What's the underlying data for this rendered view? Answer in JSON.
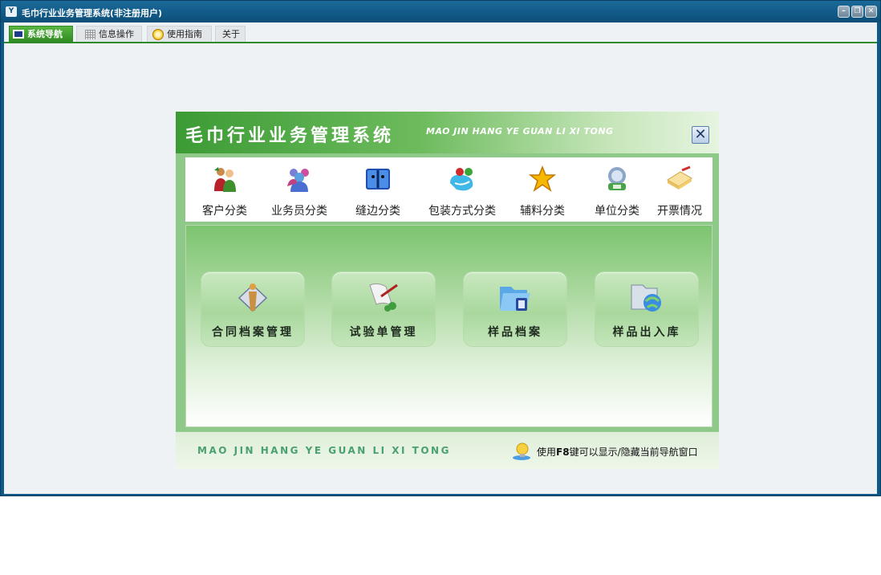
{
  "window": {
    "title": "毛巾行业业务管理系统(非注册用户)",
    "app_icon": "app-logo-icon",
    "controls": [
      "minimize-icon",
      "restore-icon",
      "close-icon"
    ]
  },
  "tabs": [
    {
      "label": "系统导航",
      "icon": "monitor-icon",
      "active": true
    },
    {
      "label": "信息操作",
      "icon": "grid-icon",
      "active": false
    },
    {
      "label": "使用指南",
      "icon": "clock-icon",
      "active": false
    },
    {
      "label": "关于",
      "icon": "",
      "active": false
    }
  ],
  "navigator": {
    "title": "毛巾行业业务管理系统",
    "subtitle": "MAO JIN HANG YE GUAN LI XI TONG",
    "close_symbol": "✕",
    "toolbar": [
      {
        "label": "客户分类",
        "icon": "customers-icon"
      },
      {
        "label": "业务员分类",
        "icon": "salesmen-icon"
      },
      {
        "label": "缝边分类",
        "icon": "sewing-edge-icon"
      },
      {
        "label": "包装方式分类",
        "icon": "packaging-icon"
      },
      {
        "label": "辅料分类",
        "icon": "star-icon"
      },
      {
        "label": "单位分类",
        "icon": "unit-icon"
      },
      {
        "label": "开票情况",
        "icon": "invoice-icon"
      }
    ],
    "main_buttons": [
      {
        "label": "合同档案管理",
        "icon": "contract-icon"
      },
      {
        "label": "试验单管理",
        "icon": "test-sheet-icon"
      },
      {
        "label": "样品档案",
        "icon": "sample-folder-icon"
      },
      {
        "label": "样品出入库",
        "icon": "sample-inout-icon"
      }
    ],
    "footer": {
      "text": "MAO JIN HANG YE GUAN LI XI TONG",
      "hint_prefix": "使用",
      "hint_key": "F8",
      "hint_suffix": "键可以显示/隐藏当前导航窗口",
      "hint_icon": "lightbulb-icon"
    }
  }
}
